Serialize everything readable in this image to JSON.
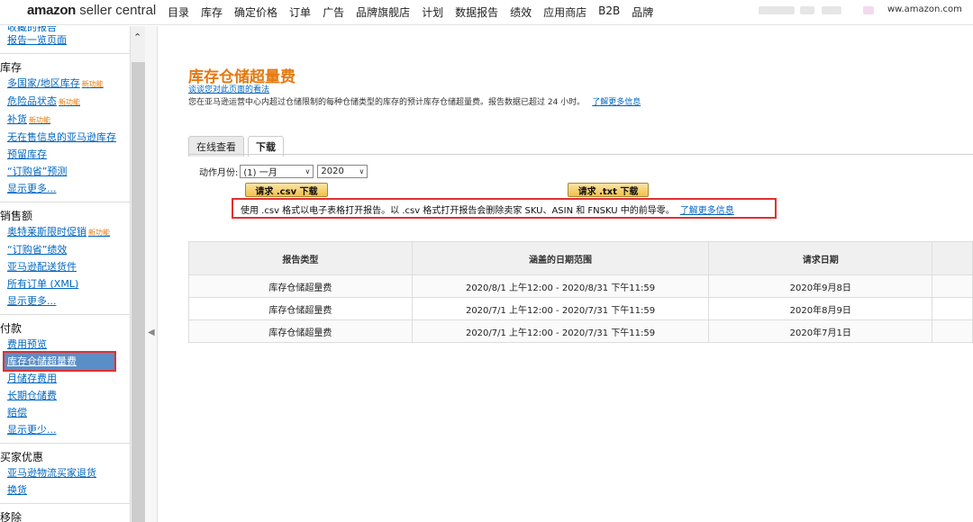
{
  "logo": {
    "brand": "amazon",
    "suffix": "seller central"
  },
  "nav": [
    "目录",
    "库存",
    "确定价格",
    "订单",
    "广告",
    "品牌旗舰店",
    "计划",
    "数据报告",
    "绩效",
    "应用商店",
    "B2B",
    "品牌"
  ],
  "url": "ww.amazon.com",
  "sidebar": {
    "top_partial": "报告一览页面",
    "sections": [
      {
        "head": "库存",
        "items": [
          {
            "label": "多国家/地区库存",
            "new": "新功能"
          },
          {
            "label": "危险品状态",
            "new": "新功能"
          },
          {
            "label": "补货",
            "new": "新功能"
          },
          {
            "label": "无在售信息的亚马逊库存",
            "new": ""
          },
          {
            "label": "预留库存",
            "new": ""
          },
          {
            "label": "“订购省”预测",
            "new": ""
          },
          {
            "label": "显示更多...",
            "new": ""
          }
        ]
      },
      {
        "head": "销售额",
        "items": [
          {
            "label": "奥特莱斯限时促销",
            "new": "新功能"
          },
          {
            "label": "“订购省”绩效",
            "new": ""
          },
          {
            "label": "亚马逊配送货件",
            "new": ""
          },
          {
            "label": "所有订单 (XML)",
            "new": ""
          },
          {
            "label": "显示更多...",
            "new": ""
          }
        ]
      },
      {
        "head": "付款",
        "items": [
          {
            "label": "费用预览",
            "new": ""
          },
          {
            "label": "库存仓储超量费",
            "new": "",
            "active": true
          },
          {
            "label": "月储存费用",
            "new": ""
          },
          {
            "label": "长期仓储费",
            "new": ""
          },
          {
            "label": "赔偿",
            "new": ""
          },
          {
            "label": "显示更少...",
            "new": ""
          }
        ]
      },
      {
        "head": "买家优惠",
        "items": [
          {
            "label": "亚马逊物流买家退货",
            "new": ""
          },
          {
            "label": "换货",
            "new": ""
          }
        ]
      },
      {
        "head": "移除",
        "items": []
      }
    ]
  },
  "page": {
    "title": "库存仓储超量费",
    "feedback": "谈谈您对此页面的看法",
    "description": "您在亚马逊运营中心内超过仓储限制的每种仓储类型的库存的预计库存仓储超量费。报告数据已超过 24 小时。",
    "learn_more": "了解更多信息",
    "tabs": [
      "在线查看",
      "下载"
    ],
    "month_label": "动作月份:",
    "month_value": "(1) 一月",
    "year_value": "2020",
    "csv_button": "请求 .csv 下载",
    "txt_button": "请求 .txt 下载",
    "notice": "使用 .csv 格式以电子表格打开报告。以 .csv 格式打开报告会删除卖家 SKU、ASIN 和 FNSKU 中的前导零。",
    "notice_link": "了解更多信息"
  },
  "table": {
    "headers": [
      "报告类型",
      "涵盖的日期范围",
      "请求日期",
      ""
    ],
    "rows": [
      [
        "库存仓储超量费",
        "2020/8/1 上午12:00 - 2020/8/31 下午11:59",
        "2020年9月8日",
        ""
      ],
      [
        "库存仓储超量费",
        "2020/7/1 上午12:00 - 2020/7/31 下午11:59",
        "2020年8月9日",
        ""
      ],
      [
        "库存仓储超量费",
        "2020/7/1 上午12:00 - 2020/7/31 下午11:59",
        "2020年7月1日",
        ""
      ]
    ]
  }
}
